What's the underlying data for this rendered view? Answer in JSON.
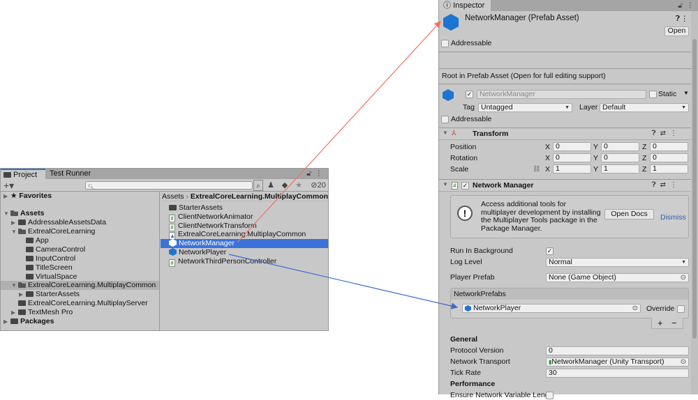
{
  "project": {
    "tabs": [
      "Project",
      "Test Runner"
    ],
    "hidden_count": "20",
    "tree": [
      {
        "label": "Favorites",
        "bold": true
      },
      {
        "label": "Assets",
        "bold": true
      },
      {
        "label": "AddressableAssetsData"
      },
      {
        "label": "ExtrealCoreLearning"
      },
      {
        "label": "App"
      },
      {
        "label": "CameraControl"
      },
      {
        "label": "InputControl"
      },
      {
        "label": "TitleScreen"
      },
      {
        "label": "VirtualSpace"
      },
      {
        "label": "ExtrealCoreLearning.MultiplayCommon"
      },
      {
        "label": "StarterAssets"
      },
      {
        "label": "ExtrealCoreLearning.MultiplayServer"
      },
      {
        "label": "TextMesh Pro"
      },
      {
        "label": "Packages",
        "bold": true
      }
    ],
    "breadcrumb": [
      "Assets",
      "ExtrealCoreLearning.MultiplayCommon"
    ],
    "files": [
      "StarterAssets",
      "ClientNetworkAnimator",
      "ClientNetworkTransform",
      "ExtrealCoreLearning.MultiplayCommon",
      "NetworkManager",
      "NetworkPlayer",
      "NetworkThirdPersonController"
    ],
    "selected_color": "#3a72d9"
  },
  "inspector": {
    "tab": "Inspector",
    "title": "NetworkManager (Prefab Asset)",
    "open": "Open",
    "addressable": "Addressable",
    "root_msg": "Root in Prefab Asset (Open for full editing support)",
    "name": "NetworkManager",
    "static": "Static",
    "tag_label": "Tag",
    "tag": "Untagged",
    "layer_label": "Layer",
    "layer": "Default",
    "transform": {
      "title": "Transform",
      "rows": [
        {
          "label": "Position",
          "x": "0",
          "y": "0",
          "z": "0"
        },
        {
          "label": "Rotation",
          "x": "0",
          "y": "0",
          "z": "0"
        },
        {
          "label": "Scale",
          "x": "1",
          "y": "1",
          "z": "1"
        }
      ],
      "axes": [
        "X",
        "Y",
        "Z"
      ]
    },
    "nm": {
      "title": "Network Manager",
      "help": "Access additional tools for multiplayer development by installing the Multiplayer Tools package in the Package Manager.",
      "open_docs": "Open Docs",
      "dismiss": "Dismiss",
      "run_bg": "Run In Background",
      "log_level_label": "Log Level",
      "log_level": "Normal",
      "player_prefab_label": "Player Prefab",
      "player_prefab": "None (Game Object)",
      "prefabs_header": "NetworkPrefabs",
      "prefab_item": "NetworkPlayer",
      "override": "Override",
      "plus": "+",
      "minus": "−",
      "general": "General",
      "protocol_label": "Protocol Version",
      "protocol": "0",
      "transport_label": "Network Transport",
      "transport": "NetworkManager (Unity Transport)",
      "tick_label": "Tick Rate",
      "tick": "30",
      "performance": "Performance",
      "ensure": "Ensure Network Variable Leng"
    }
  }
}
